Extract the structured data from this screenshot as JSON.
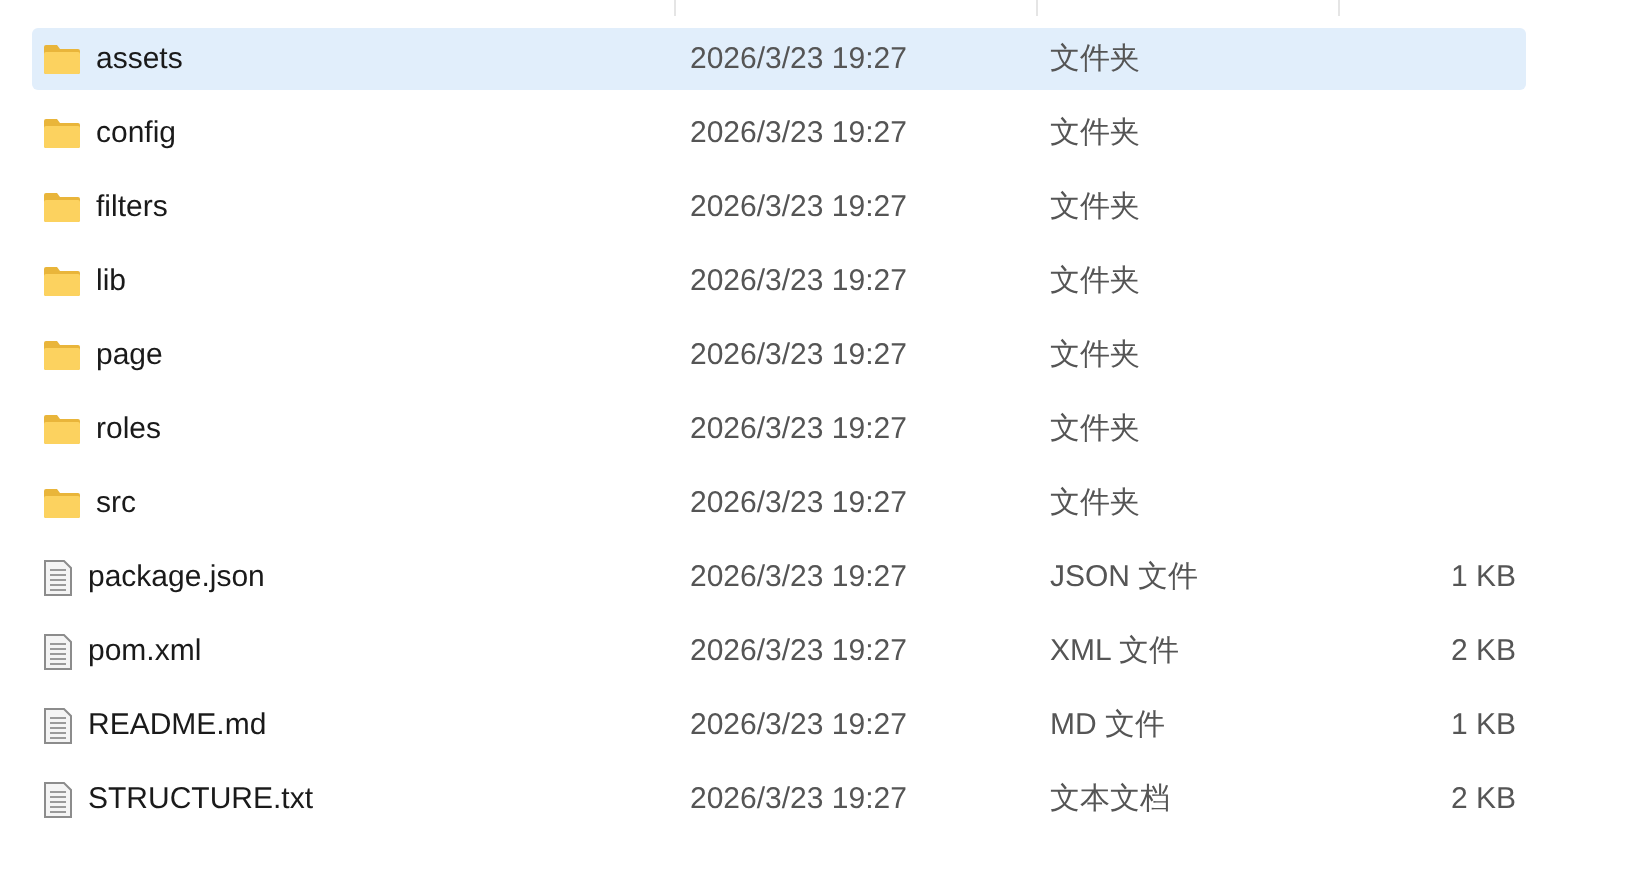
{
  "files": [
    {
      "kind": "folder",
      "name": "assets",
      "modified": "2026/3/23 19:27",
      "type": "文件夹",
      "selected": true
    },
    {
      "kind": "folder",
      "name": "config",
      "modified": "2026/3/23 19:27",
      "type": "文件夹",
      "selected": false
    },
    {
      "kind": "folder",
      "name": "filters",
      "modified": "2026/3/23 19:27",
      "type": "文件夹",
      "selected": false
    },
    {
      "kind": "folder",
      "name": "lib",
      "modified": "2026/3/23 19:27",
      "type": "文件夹",
      "selected": false
    },
    {
      "kind": "folder",
      "name": "page",
      "modified": "2026/3/23 19:27",
      "type": "文件夹",
      "selected": false
    },
    {
      "kind": "folder",
      "name": "roles",
      "modified": "2026/3/23 19:27",
      "type": "文件夹",
      "selected": false
    },
    {
      "kind": "folder",
      "name": "src",
      "modified": "2026/3/23 19:27",
      "type": "文件夹",
      "selected": false
    },
    {
      "kind": "file",
      "name": "package.json",
      "modified": "2026/3/23 19:27",
      "type": "JSON 文件",
      "size": "1 KB",
      "selected": false
    },
    {
      "kind": "file",
      "name": "pom.xml",
      "modified": "2026/3/23 19:27",
      "type": "XML 文件",
      "size": "2 KB",
      "selected": false
    },
    {
      "kind": "file",
      "name": "README.md",
      "modified": "2026/3/23 19:27",
      "type": "MD 文件",
      "size": "1 KB",
      "selected": false
    },
    {
      "kind": "file",
      "name": "STRUCTURE.txt",
      "modified": "2026/3/23 19:27",
      "type": "文本文档",
      "size": "2 KB",
      "selected": false
    }
  ]
}
